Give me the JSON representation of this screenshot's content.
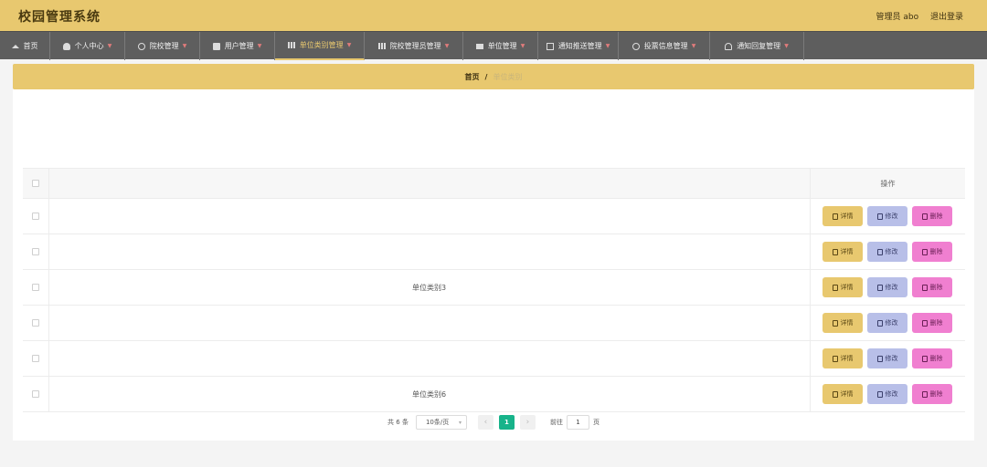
{
  "app": {
    "title": "校园管理系统"
  },
  "header": {
    "role_user": "管理员 abo",
    "logout": "退出登录"
  },
  "nav": [
    {
      "label": "首页",
      "icon": "home-icon",
      "caret": false,
      "active": false
    },
    {
      "label": "个人中心",
      "icon": "user-icon",
      "caret": true,
      "active": false
    },
    {
      "label": "院校管理",
      "icon": "circle-check-icon",
      "caret": true,
      "active": false
    },
    {
      "label": "用户管理",
      "icon": "chat-icon",
      "caret": true,
      "active": false
    },
    {
      "label": "单位类别管理",
      "icon": "bar-chart-icon",
      "caret": true,
      "active": true
    },
    {
      "label": "院校管理员管理",
      "icon": "stats-icon",
      "caret": true,
      "active": false
    },
    {
      "label": "单位管理",
      "icon": "monitor-icon",
      "caret": true,
      "active": false
    },
    {
      "label": "通知推送管理",
      "icon": "message-box-icon",
      "caret": true,
      "active": false
    },
    {
      "label": "投票信息管理",
      "icon": "clock-icon",
      "caret": true,
      "active": false
    },
    {
      "label": "通知回复管理",
      "icon": "bell-icon",
      "caret": true,
      "active": false
    }
  ],
  "breadcrumb": {
    "home": "首页",
    "sep": "/",
    "current": "单位类别"
  },
  "table": {
    "ops_header": "操作",
    "rows": [
      {
        "name": ""
      },
      {
        "name": ""
      },
      {
        "name": "单位类别3"
      },
      {
        "name": ""
      },
      {
        "name": ""
      },
      {
        "name": "单位类别6"
      }
    ],
    "actions": {
      "detail": "详情",
      "edit": "修改",
      "delete": "删除"
    }
  },
  "pagination": {
    "total": "共 6 条",
    "page_size": "10条/页",
    "current_page": "1",
    "goto_label": "前往",
    "goto_value": "1",
    "page_suffix": "页"
  },
  "colors": {
    "accent": "#e8c86f",
    "nav_bg": "#5e5e5e",
    "edit": "#b8bfe8",
    "delete": "#f07fd0",
    "page_active": "#17b38a"
  }
}
